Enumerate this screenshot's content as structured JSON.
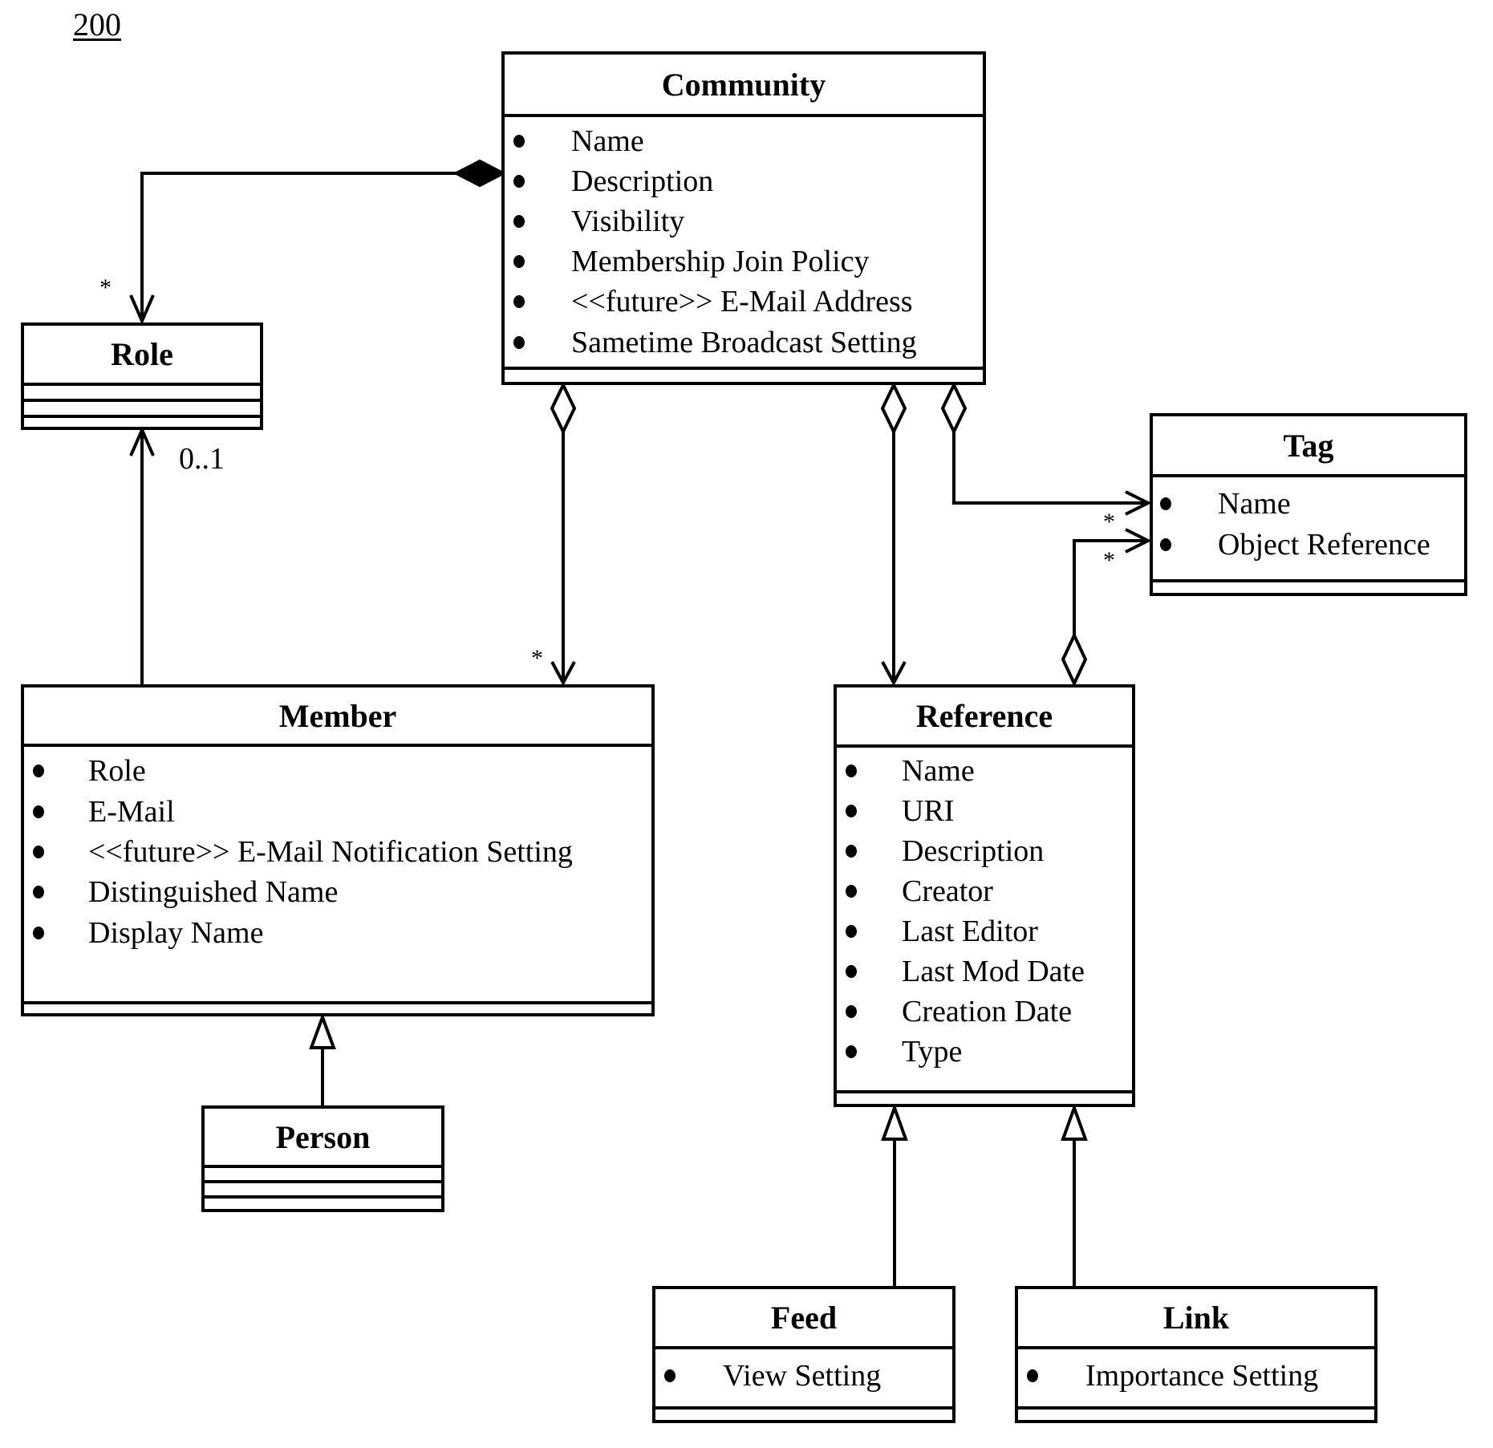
{
  "figure_label": "200",
  "classes": {
    "community": {
      "name": "Community",
      "attributes": [
        "Name",
        "Description",
        "Visibility",
        "Membership Join Policy",
        "<<future>> E-Mail Address",
        "Sametime Broadcast Setting"
      ]
    },
    "role": {
      "name": "Role",
      "attributes": []
    },
    "tag": {
      "name": "Tag",
      "attributes": [
        "Name",
        "Object Reference"
      ]
    },
    "member": {
      "name": "Member",
      "attributes": [
        "Role",
        "E-Mail",
        "<<future>> E-Mail Notification Setting",
        "Distinguished Name",
        "Display Name"
      ]
    },
    "reference": {
      "name": "Reference",
      "attributes": [
        "Name",
        "URI",
        "Description",
        "Creator",
        "Last Editor",
        "Last Mod Date",
        "Creation Date",
        "Type"
      ]
    },
    "person": {
      "name": "Person",
      "attributes": []
    },
    "feed": {
      "name": "Feed",
      "attributes": [
        "View Setting"
      ]
    },
    "link": {
      "name": "Link",
      "attributes": [
        "Importance Setting"
      ]
    }
  },
  "relationships": [
    {
      "type": "composition",
      "from": "Community",
      "to": "Role",
      "multiplicity_to": "*"
    },
    {
      "type": "association",
      "from": "Member",
      "to": "Role",
      "multiplicity_to": "0..1"
    },
    {
      "type": "aggregation",
      "from": "Community",
      "to": "Member",
      "multiplicity_to": "*"
    },
    {
      "type": "aggregation",
      "from": "Community",
      "to": "Reference",
      "multiplicity_to": ""
    },
    {
      "type": "aggregation",
      "from": "Community",
      "to": "Tag",
      "multiplicity_to": "*"
    },
    {
      "type": "aggregation",
      "from": "Reference",
      "to": "Tag",
      "multiplicity_to": "*"
    },
    {
      "type": "generalization",
      "from": "Person",
      "to": "Member"
    },
    {
      "type": "generalization",
      "from": "Feed",
      "to": "Reference"
    },
    {
      "type": "generalization",
      "from": "Link",
      "to": "Reference"
    }
  ],
  "multiplicities": {
    "role_star": "*",
    "role_zero_one": "0..1",
    "member_star": "*",
    "tag_star_1": "*",
    "tag_star_2": "*"
  }
}
